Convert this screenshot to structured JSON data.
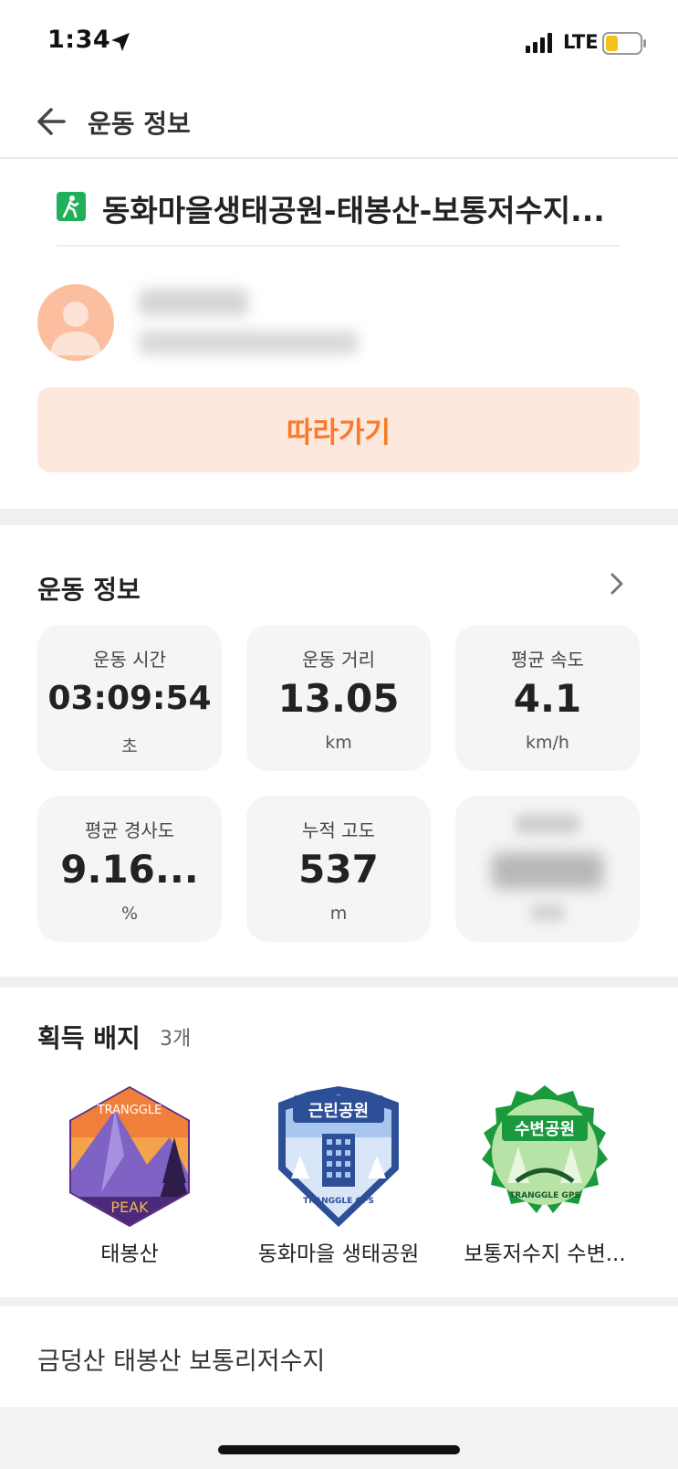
{
  "status_bar": {
    "time": "1:34",
    "network": "LTE",
    "battery_color": "#f6c21a"
  },
  "header": {
    "title": "운동 정보"
  },
  "activity": {
    "title": "동화마을생태공원-태봉산-보통저수지...",
    "icon": "hiking-icon",
    "icon_color": "#1fb15a"
  },
  "user": {
    "avatar_color": "#fbbfa0"
  },
  "follow_button": {
    "label": "따라가기",
    "text_color": "#fa7a2b",
    "bg_color": "#fde8dd"
  },
  "stats": {
    "title": "운동 정보",
    "cards": [
      {
        "label": "운동 시간",
        "value": "03:09:54",
        "unit": "초"
      },
      {
        "label": "운동 거리",
        "value": "13.05",
        "unit": "km"
      },
      {
        "label": "평균 속도",
        "value": "4.1",
        "unit": "km/h"
      },
      {
        "label": "평균 경사도",
        "value": "9.16...",
        "unit": "%"
      },
      {
        "label": "누적 고도",
        "value": "537",
        "unit": "m"
      }
    ]
  },
  "badges": {
    "title": "획득 배지",
    "count": "3개",
    "items": [
      {
        "name": "태봉산",
        "icon": "mountain-peak-badge",
        "badge_text_top": "TRANGGLE",
        "badge_text_bottom": "PEAK"
      },
      {
        "name": "동화마을 생태공원",
        "icon": "neighborhood-park-badge",
        "badge_text_top": "근린공원",
        "badge_text_bottom": "TRANGGLE GPS"
      },
      {
        "name": "보통저수지 수변...",
        "icon": "waterside-park-badge",
        "badge_text_top": "수변공원",
        "badge_text_bottom": "TRANGGLE GPS"
      }
    ]
  },
  "memo": {
    "text": "금덩산 태봉산 보통리저수지"
  }
}
